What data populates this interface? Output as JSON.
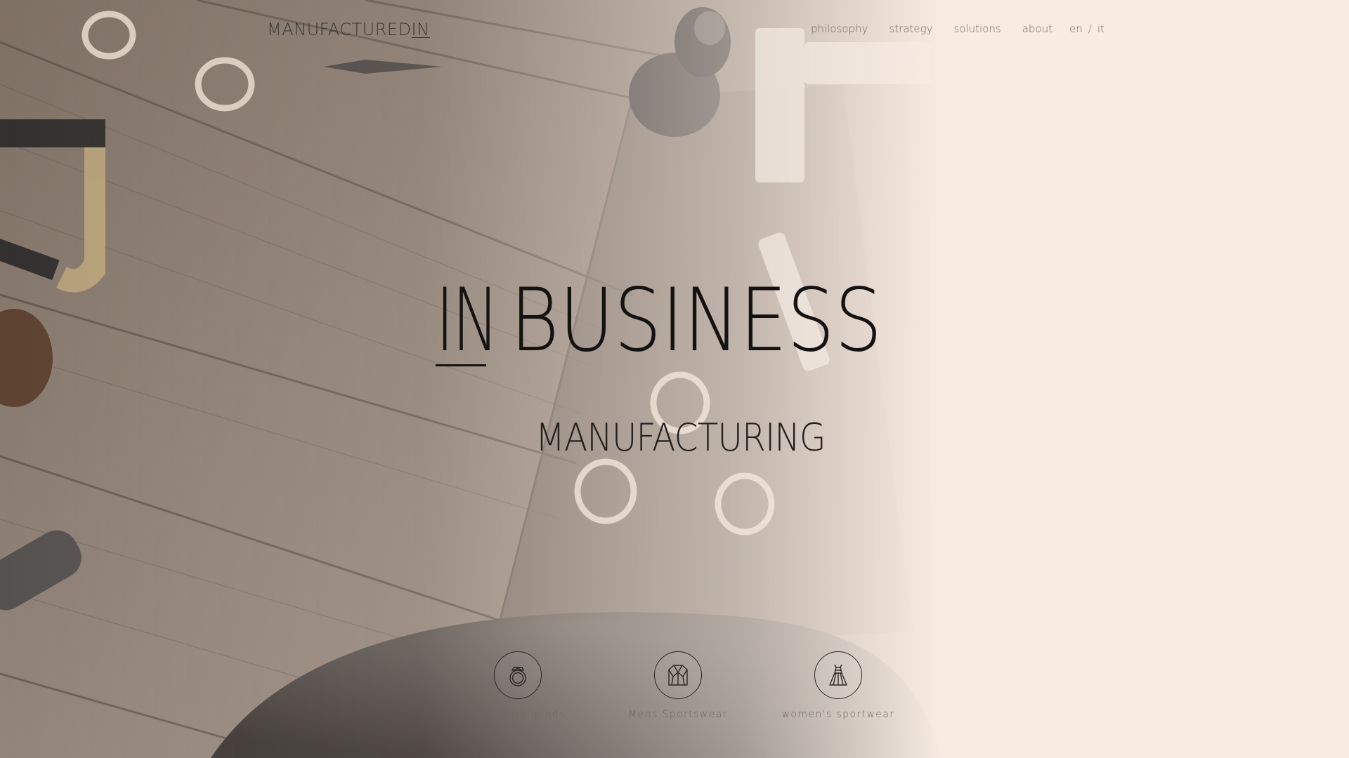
{
  "header": {
    "logo_main": "MANUFACTURED",
    "logo_in": "IN",
    "nav": [
      {
        "label": "philosophy"
      },
      {
        "label": "strategy"
      },
      {
        "label": "solutions"
      },
      {
        "label": "about"
      }
    ],
    "lang": {
      "en": "en",
      "separator": "/",
      "it": "it"
    }
  },
  "hero": {
    "title_in": "IN",
    "title_main": "BUSINESS",
    "subtitle": "MANUFACTURING"
  },
  "categories": [
    {
      "label": "speciality goods",
      "icon": "ring-icon"
    },
    {
      "label": "Mens Sportswear",
      "icon": "jacket-icon"
    },
    {
      "label": "women's sportwear",
      "icon": "dress-icon"
    }
  ],
  "colors": {
    "background": "#f7ebe2",
    "wood": "#8a7a6c",
    "text_dark": "#141312",
    "nav_text": "#6e6660"
  }
}
